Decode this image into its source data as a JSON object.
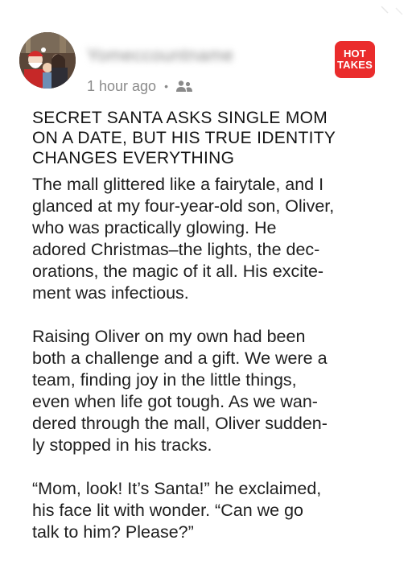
{
  "post": {
    "author_name": "Yomeccountname",
    "time_ago": "1 hour ago",
    "separator": "•",
    "audience_icon": "people-icon",
    "badge": {
      "line1": "HOT",
      "line2": "TAKES",
      "color": "#ea2c2c"
    }
  },
  "article": {
    "headline_lines": [
      "SECRET SANTA ASKS SINGLE MOM",
      "ON A DATE, BUT HIS TRUE IDENTITY",
      "CHANGES EVERYTHING"
    ],
    "paragraphs": [
      [
        "The mall glittered like a fairytale, and I",
        "glanced at my four-year-old son, Oliver,",
        "who was practically glowing. He",
        "adored Christmas–the lights, the dec-",
        "orations, the magic of it all. His excite-",
        "ment was infectious."
      ],
      [
        "Raising Oliver on my own had been",
        "both a challenge and a gift. We were a",
        "team, finding joy in the little things,",
        "even when life got tough. As we wan-",
        "dered through the mall, Oliver sudden-",
        "ly stopped in his tracks."
      ],
      [
        "“Mom, look! It’s Santa!” he exclaimed,",
        "his face lit with wonder. “Can we go",
        "talk to him? Please?”"
      ]
    ]
  }
}
